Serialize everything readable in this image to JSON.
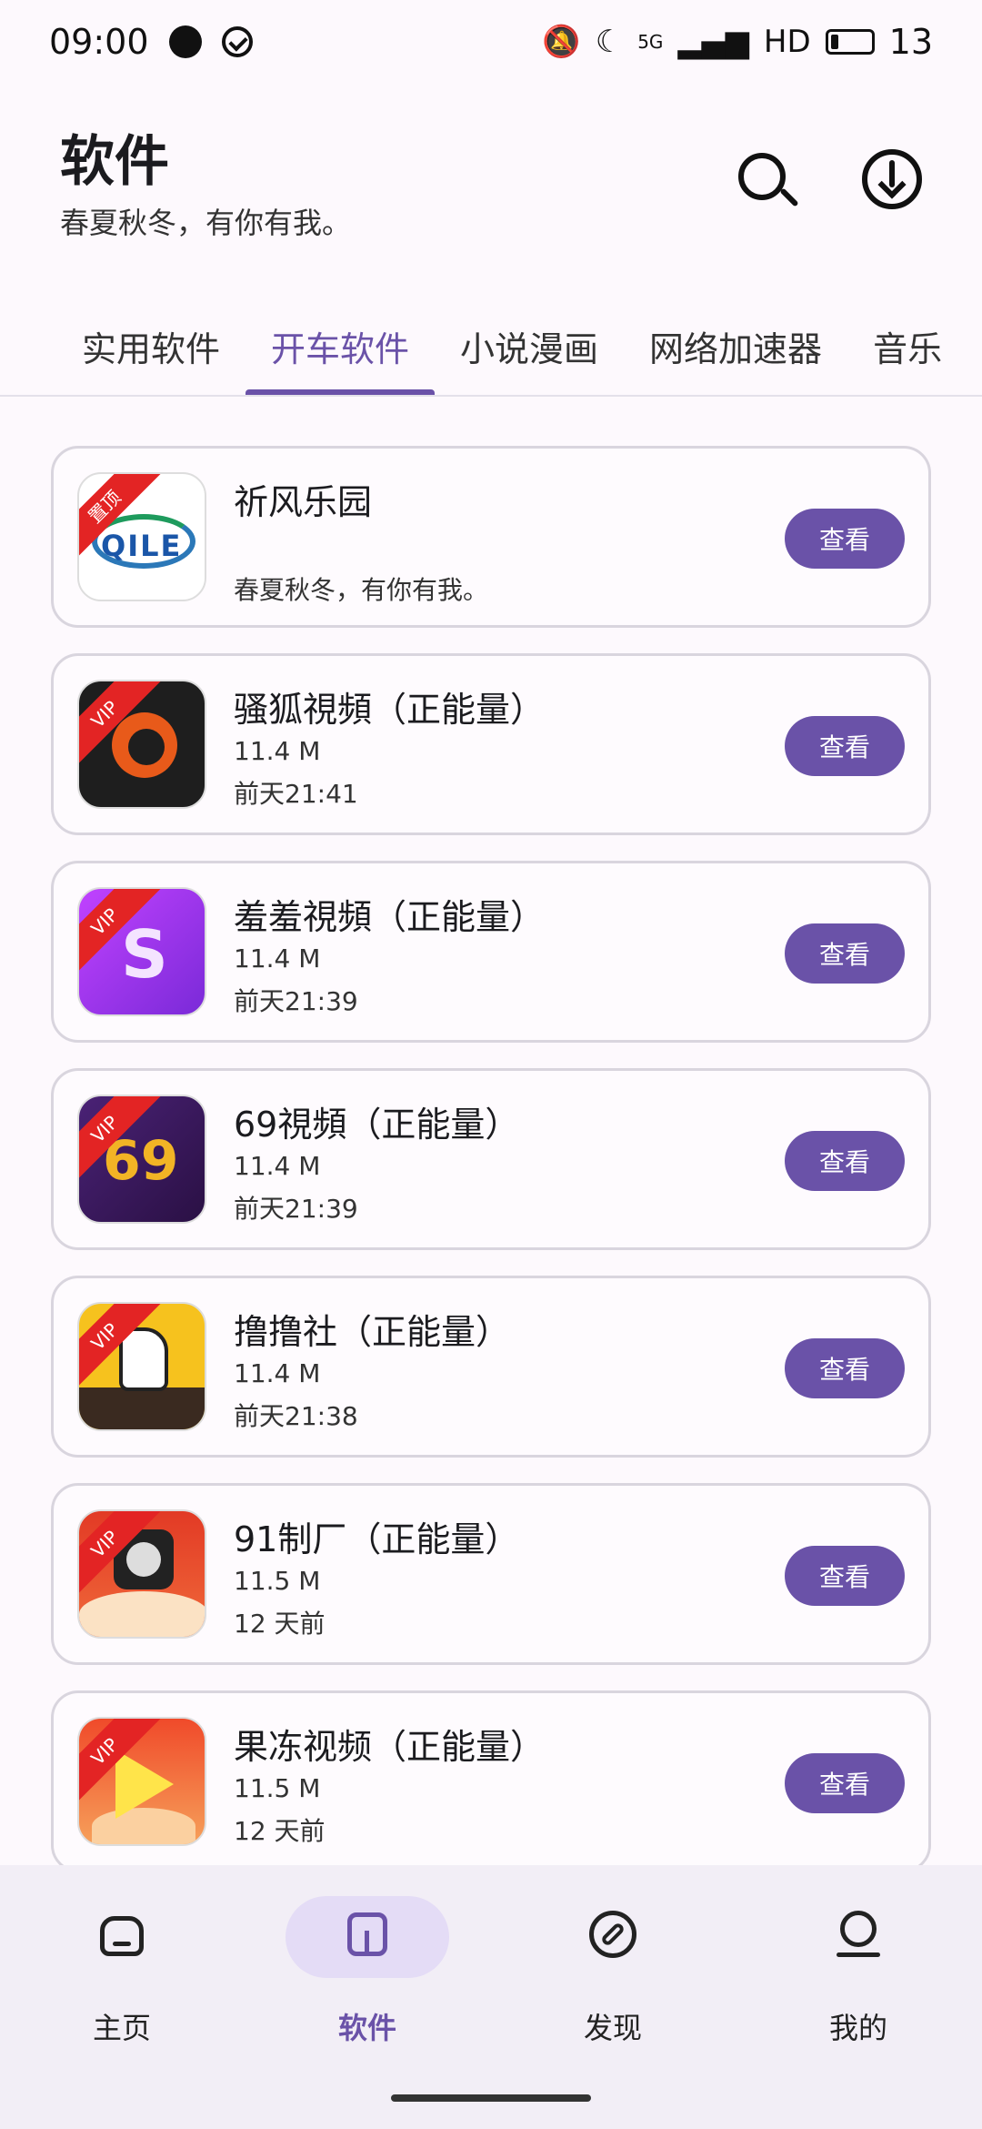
{
  "status_bar": {
    "time": "09:00",
    "network": "5G",
    "hd": "HD",
    "battery": "13"
  },
  "header": {
    "title": "软件",
    "subtitle": "春夏秋冬，有你有我。"
  },
  "tabs": [
    {
      "label": "实用软件",
      "active": false
    },
    {
      "label": "开车软件",
      "active": true
    },
    {
      "label": "小说漫画",
      "active": false
    },
    {
      "label": "网络加速器",
      "active": false
    },
    {
      "label": "音乐",
      "active": false
    }
  ],
  "apps": [
    {
      "name": "祈风乐园",
      "badge": "置顶",
      "desc": "春夏秋冬，有你有我。",
      "button": "查看",
      "icon": "qile-icon",
      "icon_text": "QILE"
    },
    {
      "name": "骚狐視頻（正能量）",
      "badge": "VIP",
      "size": "11.4 M",
      "date": "前天21:41",
      "button": "查看",
      "icon": "fox-icon"
    },
    {
      "name": "羞羞視頻（正能量）",
      "badge": "VIP",
      "size": "11.4 M",
      "date": "前天21:39",
      "button": "查看",
      "icon": "shy-icon"
    },
    {
      "name": "69視頻（正能量）",
      "badge": "VIP",
      "size": "11.4 M",
      "date": "前天21:39",
      "button": "查看",
      "icon": "sixty-nine-icon",
      "icon_text": "69"
    },
    {
      "name": "撸撸社（正能量）",
      "badge": "VIP",
      "size": "11.4 M",
      "date": "前天21:38",
      "button": "查看",
      "icon": "thumb-icon"
    },
    {
      "name": "91制厂（正能量）",
      "badge": "VIP",
      "size": "11.5 M",
      "date": "12 天前",
      "button": "查看",
      "icon": "film-reel-icon"
    },
    {
      "name": "果冻视频（正能量）",
      "badge": "VIP",
      "size": "11.5 M",
      "date": "12 天前",
      "button": "查看",
      "icon": "jelly-play-icon"
    }
  ],
  "bottom_nav": [
    {
      "label": "主页",
      "icon": "home-icon",
      "active": false
    },
    {
      "label": "软件",
      "icon": "cube-icon",
      "active": true
    },
    {
      "label": "发现",
      "icon": "compass-icon",
      "active": false
    },
    {
      "label": "我的",
      "icon": "person-icon",
      "active": false
    }
  ],
  "colors": {
    "accent": "#6a52a8",
    "badge_red": "#e32424",
    "background": "#fdf9fd"
  }
}
